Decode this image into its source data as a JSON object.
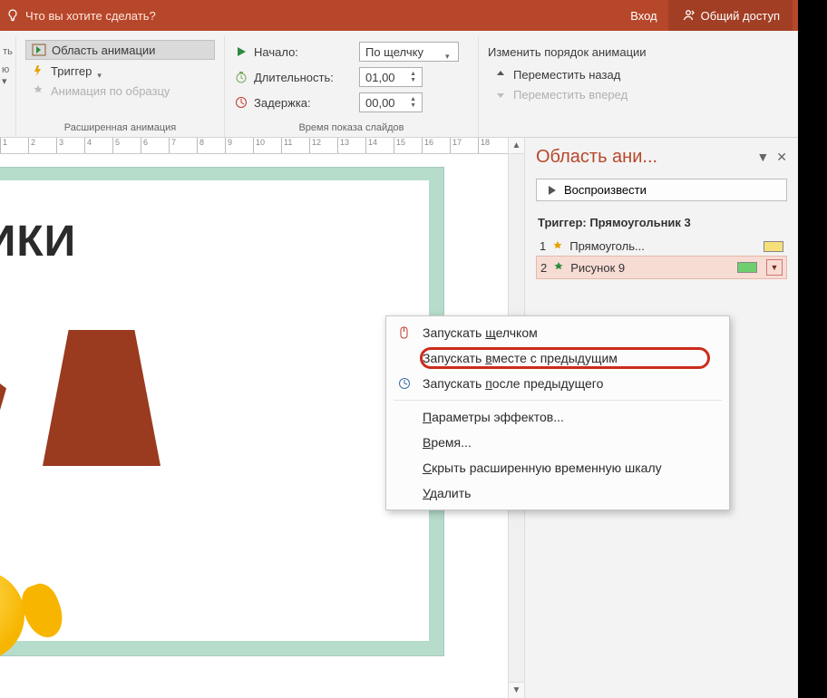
{
  "titlebar": {
    "prompt": "Что вы хотите сделать?",
    "signin": "Вход",
    "share": "Общий доступ"
  },
  "ribbon": {
    "group_anim_ext": {
      "animation_pane": "Область анимации",
      "trigger": "Триггер",
      "by_example": "Анимация по образцу",
      "title": "Расширенная анимация"
    },
    "group_timing": {
      "start_label": "Начало:",
      "start_value": "По щелчку",
      "duration_label": "Длительность:",
      "duration_value": "01,00",
      "delay_label": "Задержка:",
      "delay_value": "00,00",
      "title": "Время показа слайдов"
    },
    "group_reorder": {
      "title_label": "Изменить порядок анимации",
      "move_earlier": "Переместить назад",
      "move_later": "Переместить вперед"
    }
  },
  "slide": {
    "title_text": "ЛЬНИКИ"
  },
  "pane": {
    "title": "Область ани...",
    "play": "Воспроизвести",
    "trigger_label": "Триггер: Прямоугольник 3",
    "items": [
      {
        "num": "1",
        "name": "Прямоуголь...",
        "swatch": "#f6e07a"
      },
      {
        "num": "2",
        "name": "Рисунок 9",
        "swatch": "#6fcf6f"
      }
    ]
  },
  "menu": {
    "on_click": "Запускать щелчком",
    "with_prev": "Запускать вместе с предыдущим",
    "after_prev": "Запускать после предыдущего",
    "effect_opts": "Параметры эффектов...",
    "timing": "Время...",
    "hide_timeline": "Скрыть расширенную временную шкалу",
    "remove": "Удалить"
  },
  "ruler_ticks": [
    "1",
    "2",
    "3",
    "4",
    "5",
    "6",
    "7",
    "8",
    "9",
    "10",
    "11",
    "12",
    "13",
    "14",
    "15",
    "16",
    "17",
    "18"
  ]
}
